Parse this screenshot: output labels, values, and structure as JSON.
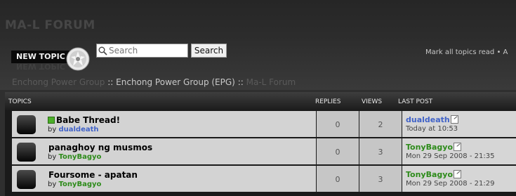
{
  "forum": {
    "title": "MA-L FORUM"
  },
  "toolbar": {
    "new_topic_label": "NEW TOPIC",
    "search_placeholder": "Search",
    "search_button": "Search",
    "mark_read": "Mark all topics read • A"
  },
  "breadcrumb": {
    "items": [
      "Enchong Power Group",
      "Enchong Power Group (EPG)",
      "Ma-L Forum"
    ],
    "separator": "::"
  },
  "table": {
    "headers": {
      "topics": "TOPICS",
      "replies": "REPLIES",
      "views": "VIEWS",
      "last_post": "LAST POST"
    },
    "by_prefix": "by",
    "rows": [
      {
        "title": "Babe Thread!",
        "author": "dualdeath",
        "replies": "0",
        "views": "2",
        "last_user": "dualdeath",
        "last_date": "Today at 10:53",
        "is_new": true
      },
      {
        "title": "panaghoy ng musmos",
        "author": "TonyBagyo",
        "replies": "0",
        "views": "3",
        "last_user": "TonyBagyo",
        "last_date": "Mon 29 Sep 2008 - 21:35",
        "is_new": false
      },
      {
        "title": "Foursome - apatan",
        "author": "TonyBagyo",
        "replies": "0",
        "views": "3",
        "last_user": "TonyBagyo",
        "last_date": "Mon 29 Sep 2008 - 21:29",
        "is_new": false
      }
    ]
  },
  "colors": {
    "user_blue": "#4062c8",
    "user_green": "#2d8b1a",
    "new_indicator": "#4caf2a"
  }
}
